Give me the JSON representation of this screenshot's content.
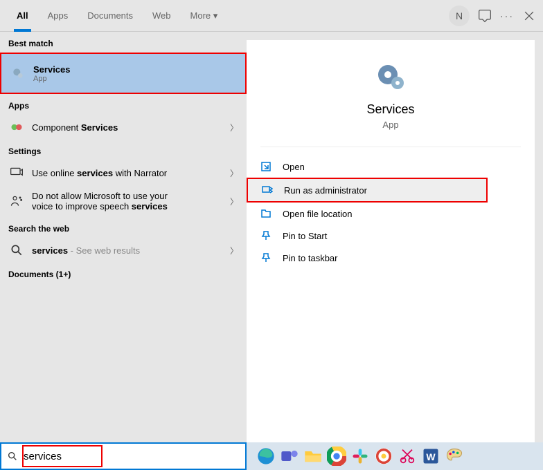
{
  "tabs": {
    "all": "All",
    "apps": "Apps",
    "documents": "Documents",
    "web": "Web",
    "more": "More"
  },
  "topbar": {
    "avatar_letter": "N"
  },
  "left": {
    "best_match": "Best match",
    "services_title": "Services",
    "services_sub": "App",
    "apps_label": "Apps",
    "component_prefix": "Component ",
    "component_bold": "Services",
    "settings_label": "Settings",
    "setting1_prefix": "Use online ",
    "setting1_bold": "services",
    "setting1_suffix": " with Narrator",
    "setting2_line1": "Do not allow Microsoft to use your",
    "setting2_line2_prefix": "voice to improve speech ",
    "setting2_line2_bold": "services",
    "search_web_label": "Search the web",
    "web_bold": "services",
    "web_suffix": " - See web results",
    "documents_label": "Documents (1+)"
  },
  "right": {
    "title": "Services",
    "sub": "App",
    "actions": {
      "open": "Open",
      "run_admin": "Run as administrator",
      "open_loc": "Open file location",
      "pin_start": "Pin to Start",
      "pin_task": "Pin to taskbar"
    }
  },
  "taskbar": {
    "search_value": "services"
  }
}
